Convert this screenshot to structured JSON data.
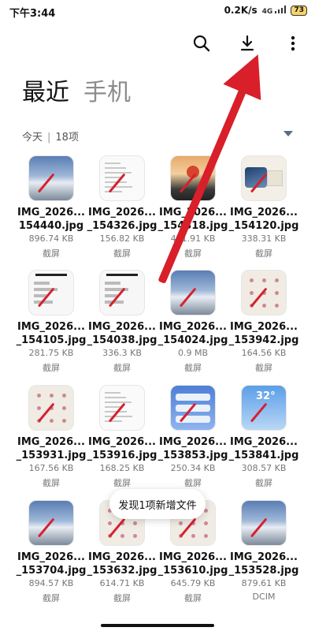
{
  "status": {
    "time": "下午3:44",
    "net_speed": "0.2K/s",
    "signal_label": "4G",
    "battery": "73"
  },
  "toolbar": {
    "search_icon": "search-icon",
    "download_icon": "download-icon",
    "more_icon": "more-vertical-icon"
  },
  "tabs": [
    {
      "label": "最近"
    },
    {
      "label": "手机"
    }
  ],
  "group": {
    "date_label": "今天",
    "count_label": "18项"
  },
  "files": [
    {
      "name1": "IMG_2026...",
      "name2": "154440.jpg",
      "size": "896.74 KB",
      "source": "截屏",
      "thumb": "mountain"
    },
    {
      "name1": "IMG_2026...",
      "name2": "_154326.jpg",
      "size": "156.82 KB",
      "source": "截屏",
      "thumb": "doc"
    },
    {
      "name1": "IMG_2026...",
      "name2": "_154318.jpg",
      "size": "451.91 KB",
      "source": "截屏",
      "thumb": "sunset"
    },
    {
      "name1": "IMG_2026...",
      "name2": "_154120.jpg",
      "size": "338.31 KB",
      "source": "截屏",
      "thumb": "wave"
    },
    {
      "name1": "IMG_2026...",
      "name2": "_154105.jpg",
      "size": "281.75 KB",
      "source": "截屏",
      "thumb": "phone"
    },
    {
      "name1": "IMG_2026...",
      "name2": "_154038.jpg",
      "size": "336.3 KB",
      "source": "截屏",
      "thumb": "phone"
    },
    {
      "name1": "IMG_2026...",
      "name2": "_154024.jpg",
      "size": "0.9 MB",
      "source": "截屏",
      "thumb": "mountain"
    },
    {
      "name1": "IMG_2026...",
      "name2": "_153942.jpg",
      "size": "164.56 KB",
      "source": "截屏",
      "thumb": "note"
    },
    {
      "name1": "IMG_2026...",
      "name2": "_153931.jpg",
      "size": "167.56 KB",
      "source": "截屏",
      "thumb": "note"
    },
    {
      "name1": "IMG_2026...",
      "name2": "_153916.jpg",
      "size": "168.25 KB",
      "source": "截屏",
      "thumb": "doc"
    },
    {
      "name1": "IMG_2026...",
      "name2": "_153853.jpg",
      "size": "250.34 KB",
      "source": "截屏",
      "thumb": "weather"
    },
    {
      "name1": "IMG_2026...",
      "name2": "_153841.jpg",
      "size": "308.57 KB",
      "source": "截屏",
      "thumb": "sky"
    },
    {
      "name1": "IMG_2026...",
      "name2": "_153704.jpg",
      "size": "894.57 KB",
      "source": "截屏",
      "thumb": "mountain"
    },
    {
      "name1": "IMG_2026...",
      "name2": "_153632.jpg",
      "size": "614.71 KB",
      "source": "截屏",
      "thumb": "note"
    },
    {
      "name1": "IMG_2026...",
      "name2": "_153610.jpg",
      "size": "645.79 KB",
      "source": "截屏",
      "thumb": "note"
    },
    {
      "name1": "IMG_2026...",
      "name2": "_153528.jpg",
      "size": "879.61 KB",
      "source": "DCIM",
      "thumb": "mountain"
    }
  ],
  "toast": {
    "text": "发现1项新增文件"
  },
  "accent_color": "#d81f2a"
}
